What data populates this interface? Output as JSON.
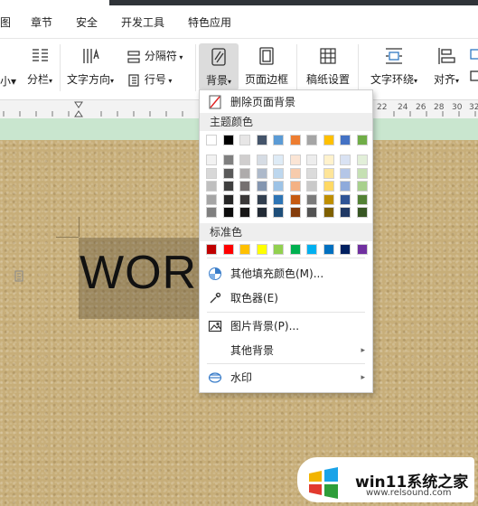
{
  "tabs": [
    {
      "label": "图"
    },
    {
      "label": "章节"
    },
    {
      "label": "安全"
    },
    {
      "label": "开发工具"
    },
    {
      "label": "特色应用"
    }
  ],
  "ribbon": {
    "partial_left": "小▾",
    "columns": "分栏",
    "text_direction": "文字方向",
    "separator": "分隔符",
    "line_number": "行号",
    "background": "背景",
    "page_border": "页面边框",
    "manuscript": "稿纸设置",
    "text_wrap": "文字环绕",
    "align": "对齐"
  },
  "ruler": [
    "22",
    "24",
    "26",
    "28",
    "30",
    "32"
  ],
  "document": {
    "text": "WOR"
  },
  "menu": {
    "remove_bg": "删除页面背景",
    "theme_colors_header": "主题颜色",
    "standard_colors_header": "标准色",
    "more_fill": "其他填充颜色(M)...",
    "eyedropper": "取色器(E)",
    "picture_bg": "图片背景(P)...",
    "other_bg": "其他背景",
    "watermark": "水印"
  },
  "theme_colors_top": [
    "#ffffff",
    "#000000",
    "#e7e6e6",
    "#44546a",
    "#5b9bd5",
    "#ed7d31",
    "#a5a5a5",
    "#ffc000",
    "#4472c4",
    "#70ad47"
  ],
  "theme_colors_shades": [
    [
      "#f2f2f2",
      "#7f7f7f",
      "#d0cece",
      "#d6dce4",
      "#deebf6",
      "#fbe5d5",
      "#ededed",
      "#fff2cc",
      "#d9e2f3",
      "#e2efd9"
    ],
    [
      "#d8d8d8",
      "#595959",
      "#aeabab",
      "#adb9ca",
      "#bdd7ee",
      "#f7cbac",
      "#dbdbdb",
      "#fee599",
      "#b4c6e7",
      "#c5e0b3"
    ],
    [
      "#bfbfbf",
      "#3f3f3f",
      "#757070",
      "#8496b0",
      "#9dc3e6",
      "#f4b183",
      "#c9c9c9",
      "#ffd965",
      "#8eaadb",
      "#a8d08d"
    ],
    [
      "#a5a5a5",
      "#262626",
      "#3a3838",
      "#323f4f",
      "#2e75b5",
      "#c55a11",
      "#7b7b7b",
      "#bf8f00",
      "#2f5496",
      "#538135"
    ],
    [
      "#7f7f7f",
      "#0c0c0c",
      "#171616",
      "#222a35",
      "#1e4e79",
      "#843c0b",
      "#525252",
      "#7f6000",
      "#1f3864",
      "#375623"
    ]
  ],
  "standard_colors": [
    "#c00000",
    "#ff0000",
    "#ffc000",
    "#ffff00",
    "#92d050",
    "#00b050",
    "#00b0f0",
    "#0070c0",
    "#002060",
    "#7030a0"
  ],
  "watermark_badge": {
    "title": "win11系统之家",
    "url": "www.relsound.com"
  }
}
